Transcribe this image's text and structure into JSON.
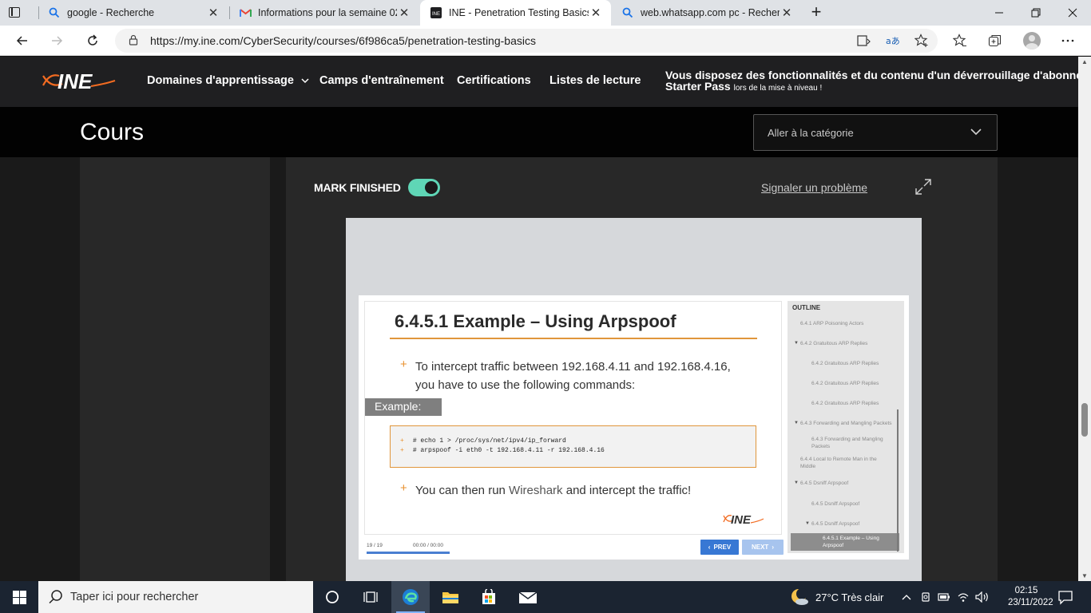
{
  "browser": {
    "tabs": [
      {
        "title": "google - Recherche",
        "icon": "search-icon"
      },
      {
        "title": "Informations pour la semaine 02",
        "icon": "gmail-icon"
      },
      {
        "title": "INE - Penetration Testing Basics",
        "icon": "ine-favicon"
      },
      {
        "title": "web.whatsapp.com pc - Recherch",
        "icon": "search-icon"
      }
    ],
    "active_tab_index": 2,
    "url": "https://my.ine.com/CyberSecurity/courses/6f986ca5/penetration-testing-basics"
  },
  "ine": {
    "nav": [
      {
        "label": "Domaines d'apprentissage"
      },
      {
        "label": "Camps d'entraînement"
      },
      {
        "label": "Certifications"
      },
      {
        "label": "Listes de lecture"
      }
    ],
    "promo": {
      "line1": "Vous disposez des fonctionnalités et du contenu d'un déverrouillage d'abonnement",
      "bold2": "Starter Pass",
      "small2": "lors de la mise à niveau !"
    },
    "page_title": "Cours",
    "category_placeholder": "Aller à la catégorie",
    "mark_finished": "MARK FINISHED",
    "mark_finished_on": true,
    "report_link": "Signaler un problème",
    "accent_color": "#5fd6b6"
  },
  "slide": {
    "title": "6.4.5.1 Example – Using Arpspoof",
    "bullet1_line1": "To intercept traffic between 192.168.4.11 and 192.168.4.16,",
    "bullet1_line2": "you have to use the following commands:",
    "example_label": "Example:",
    "code_line1": "# echo 1 > /proc/sys/net/ipv4/ip_forward",
    "code_line2": "# arpspoof -i eth0 -t 192.168.4.11 -r 192.168.4.16",
    "bullet2_prefix": "You can then run ",
    "bullet2_highlight": "Wireshark",
    "bullet2_suffix": " and intercept the traffic!",
    "logo_text": "INE"
  },
  "outline": {
    "heading": "OUTLINE",
    "items": [
      {
        "label": "6.4.1 ARP Poisoning Actors"
      },
      {
        "label": "6.4.2 Gratuitous ARP Replies"
      },
      {
        "label": "6.4.2 Gratuitous ARP Replies"
      },
      {
        "label": "6.4.2 Gratuitous ARP Replies"
      },
      {
        "label": "6.4.2 Gratuitous ARP Replies"
      },
      {
        "label": "6.4.3 Forwarding and Mangling Packets"
      },
      {
        "label": "6.4.3 Forwarding and Mangling Packets"
      },
      {
        "label": "6.4.4 Local to Remote Man in the Middle"
      },
      {
        "label": "6.4.5 Dsniff Arpspoof"
      },
      {
        "label": "6.4.5 Dsniff Arpspoof"
      },
      {
        "label": "6.4.5 Dsniff Arpspoof"
      },
      {
        "label": "6.4.5.1 Example – Using Arpspoof"
      }
    ]
  },
  "player": {
    "slide_counter": "19 / 19",
    "time": "00:00 / 00:00",
    "progress_fraction": 1.0,
    "prev_label": "PREV",
    "next_label": "NEXT"
  },
  "taskbar": {
    "search_placeholder": "Taper ici pour rechercher",
    "weather": "27°C  Très clair",
    "time": "02:15",
    "date": "23/11/2022"
  }
}
